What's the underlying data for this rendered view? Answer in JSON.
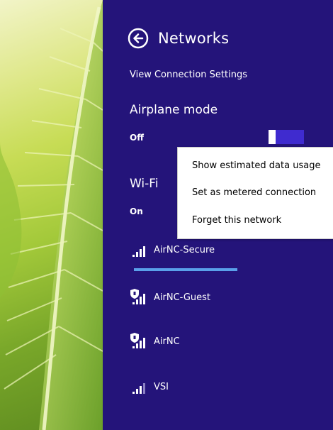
{
  "panel": {
    "title": "Networks",
    "view_connection_settings": "View Connection Settings",
    "airplane_mode": {
      "heading": "Airplane mode",
      "state": "Off",
      "enabled": false
    },
    "wifi": {
      "heading": "Wi-Fi",
      "state": "On"
    },
    "networks": [
      {
        "name": "AirNC-Secure",
        "secured": false,
        "signal": "strong",
        "selected": true
      },
      {
        "name": "AirNC-Guest",
        "secured": true,
        "signal": "strong",
        "selected": false
      },
      {
        "name": "AirNC",
        "secured": true,
        "signal": "strong",
        "selected": false
      },
      {
        "name": "VSI",
        "secured": false,
        "signal": "weak",
        "selected": false
      }
    ]
  },
  "context_menu": {
    "items": [
      "Show estimated data usage",
      "Set as metered connection",
      "Forget this network"
    ]
  },
  "colors": {
    "panel_background": "#24147a",
    "toggle_background": "#3f2bcf",
    "selection_bar": "#5aa0ea",
    "menu_background": "#ffffff"
  }
}
